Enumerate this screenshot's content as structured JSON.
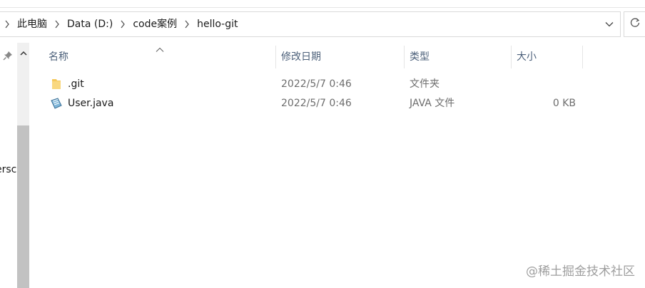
{
  "breadcrumbs": [
    "此电脑",
    "Data (D:)",
    "code案例",
    "hello-git"
  ],
  "columns": {
    "name": "名称",
    "modified": "修改日期",
    "type": "类型",
    "size": "大小"
  },
  "files": [
    {
      "name": ".git",
      "modified": "2022/5/7 0:46",
      "type": "文件夹",
      "size": "",
      "icon": "folder-icon"
    },
    {
      "name": "User.java",
      "modified": "2022/5/7 0:46",
      "type": "JAVA 文件",
      "size": "0 KB",
      "icon": "java-file-icon"
    }
  ],
  "nav_pane": {
    "partial_label": "ersc"
  },
  "watermark": "@稀土掘金技术社区",
  "colors": {
    "header_text": "#4c607a",
    "folder": "#f5c85a",
    "scroll_thumb": "#c2c2c2"
  }
}
